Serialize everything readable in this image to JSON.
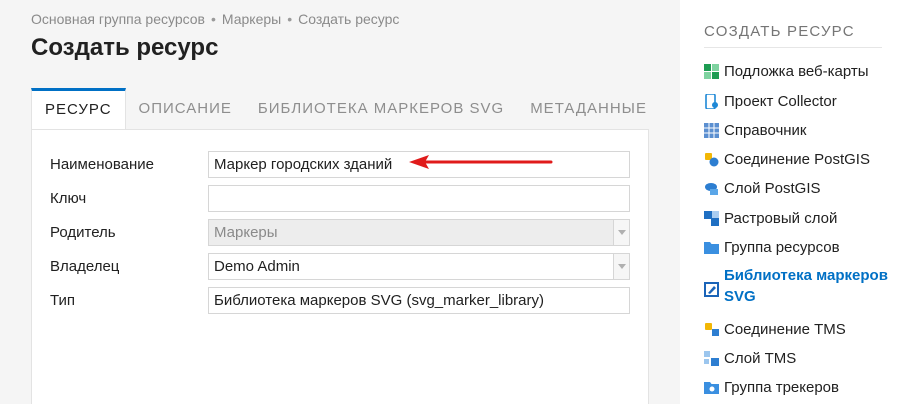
{
  "breadcrumb": [
    "Основная группа ресурсов",
    "Маркеры",
    "Создать ресурс"
  ],
  "breadcrumb_separator": "•",
  "page_title": "Создать ресурс",
  "tabs": [
    {
      "label": "РЕСУРС",
      "active": true
    },
    {
      "label": "ОПИСАНИЕ",
      "active": false
    },
    {
      "label": "БИБЛИОТЕКА МАРКЕРОВ SVG",
      "active": false
    },
    {
      "label": "МЕТАДАННЫЕ",
      "active": false
    }
  ],
  "form": {
    "name": {
      "label": "Наименование",
      "value": "Маркер городских зданий"
    },
    "key": {
      "label": "Ключ",
      "value": ""
    },
    "parent": {
      "label": "Родитель",
      "value": "Маркеры"
    },
    "owner": {
      "label": "Владелец",
      "value": "Demo Admin"
    },
    "type": {
      "label": "Тип",
      "value": "Библиотека маркеров SVG (svg_marker_library)"
    }
  },
  "annotation_arrow_color": "#e01b1b",
  "sidebar": {
    "title": "СОЗДАТЬ РЕСУРС",
    "items": [
      {
        "label": "Подложка веб-карты",
        "icon": "basemap-icon"
      },
      {
        "label": "Проект Collector",
        "icon": "collector-project-icon"
      },
      {
        "label": "Справочник",
        "icon": "lookup-table-icon"
      },
      {
        "label": "Соединение PostGIS",
        "icon": "postgis-connection-icon"
      },
      {
        "label": "Слой PostGIS",
        "icon": "postgis-layer-icon"
      },
      {
        "label": "Растровый слой",
        "icon": "raster-layer-icon"
      },
      {
        "label": "Группа ресурсов",
        "icon": "folder-icon"
      },
      {
        "label": "Библиотека маркеров SVG",
        "icon": "svg-marker-library-icon",
        "active": true
      },
      {
        "label": "Соединение TMS",
        "icon": "tms-connection-icon"
      },
      {
        "label": "Слой TMS",
        "icon": "tms-layer-icon"
      },
      {
        "label": "Группа трекеров",
        "icon": "tracker-group-icon"
      }
    ]
  },
  "colors": {
    "accent": "#0070c5",
    "background": "#f5f5f5"
  }
}
